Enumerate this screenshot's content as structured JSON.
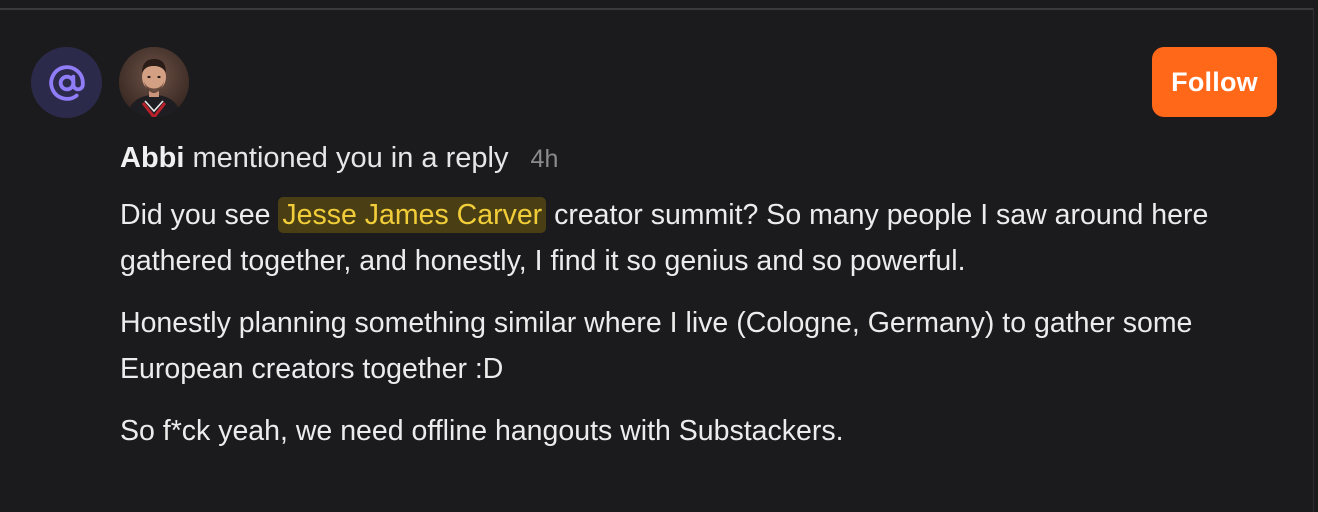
{
  "notification": {
    "actor": "Abbi",
    "action": "mentioned you in a reply",
    "time": "4h",
    "follow_label": "Follow",
    "body": {
      "p1_before": "Did you see ",
      "p1_highlight": "Jesse James Carver",
      "p1_after": " creator summit? So many people I saw around here gathered together, and honestly, I find it so genius and so powerful.",
      "p2": "Honestly planning something similar where I live (Cologne, Germany) to gather some European creators together :D",
      "p3": "So f*ck yeah, we need offline hangouts with Substackers."
    }
  },
  "icons": {
    "mention": "at-sign-icon",
    "avatar": "user-avatar"
  },
  "colors": {
    "background": "#1b1b1d",
    "accent": "#ff6719",
    "mention_badge_bg": "#2c2a4a",
    "mention_icon": "#8f7cf7",
    "highlight_bg": "#4a3f14",
    "highlight_text": "#f2cd3a",
    "muted_text": "#8a8a8f"
  }
}
